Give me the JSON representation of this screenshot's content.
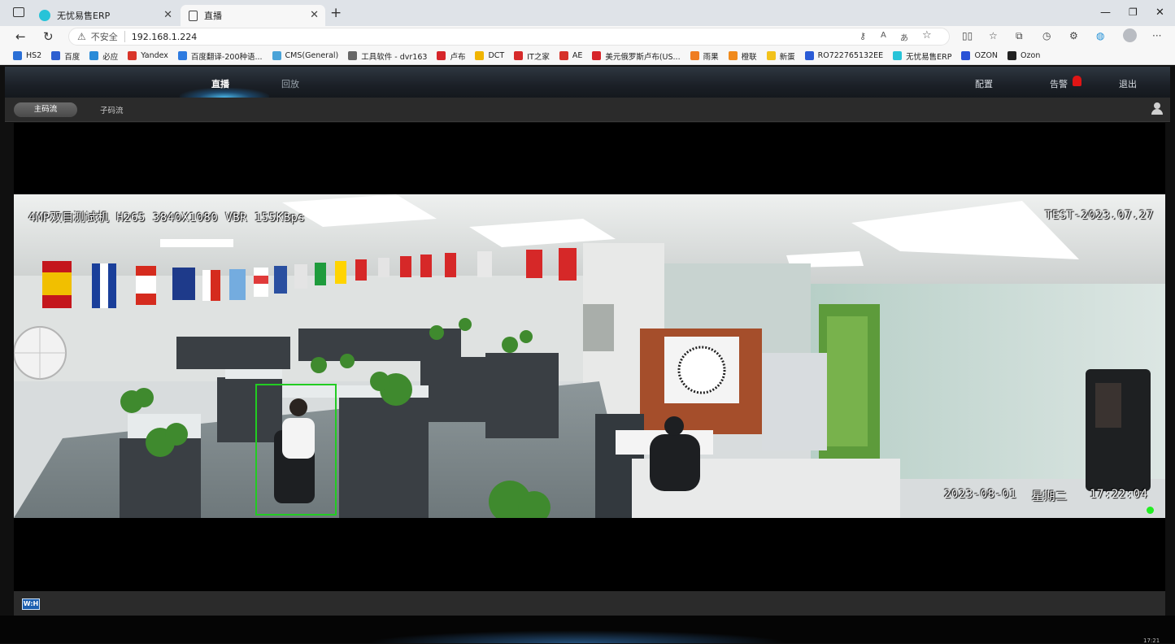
{
  "browser": {
    "tabs": [
      {
        "title": "无忧易售ERP",
        "favicon_color": "#27c3d8"
      },
      {
        "title": "直播",
        "favicon_color": "#ffffff"
      }
    ],
    "address": {
      "security_label": "不安全",
      "url": "192.168.1.224"
    },
    "bookmarks": [
      {
        "label": "HS2",
        "color": "#2a6fd6"
      },
      {
        "label": "百度",
        "color": "#2e5fd0"
      },
      {
        "label": "必应",
        "color": "#2a8bd8"
      },
      {
        "label": "Yandex",
        "color": "#d9352a"
      },
      {
        "label": "百度翻译-200种语...",
        "color": "#2e7be0"
      },
      {
        "label": "CMS(General)",
        "color": "#4aa3d8"
      },
      {
        "label": "工具软件 - dvr163",
        "color": "#666666"
      },
      {
        "label": "卢布",
        "color": "#d6252a"
      },
      {
        "label": "DCT",
        "color": "#f0b400"
      },
      {
        "label": "IT之家",
        "color": "#d62a2a"
      },
      {
        "label": "AE",
        "color": "#d6322a"
      },
      {
        "label": "美元俄罗斯卢布(US...",
        "color": "#d6252a"
      },
      {
        "label": "雨果",
        "color": "#ef7d22"
      },
      {
        "label": "橙联",
        "color": "#f08a1c"
      },
      {
        "label": "新蛋",
        "color": "#f2c21b"
      },
      {
        "label": "RO722765132EE",
        "color": "#2a5bd6"
      },
      {
        "label": "无忧易售ERP",
        "color": "#27c3d8"
      },
      {
        "label": "OZON",
        "color": "#2a52d6"
      },
      {
        "label": "Ozon",
        "color": "#222222"
      }
    ]
  },
  "nav": {
    "live": "直播",
    "playback": "回放",
    "config": "配置",
    "alarm": "告警",
    "logout": "退出"
  },
  "stream": {
    "main": "主码流",
    "sub": "子码流"
  },
  "osd": {
    "top_left": "4MP双目测试机 H265 3840X1080 VBR 155KBps",
    "top_right": "TEST-2023.07.27",
    "date": "2023-08-01",
    "weekday": "星期二",
    "time": "17:22:04"
  },
  "toolbar": {
    "wh_label": "W:H"
  },
  "footer": {
    "clock": "17:21"
  }
}
